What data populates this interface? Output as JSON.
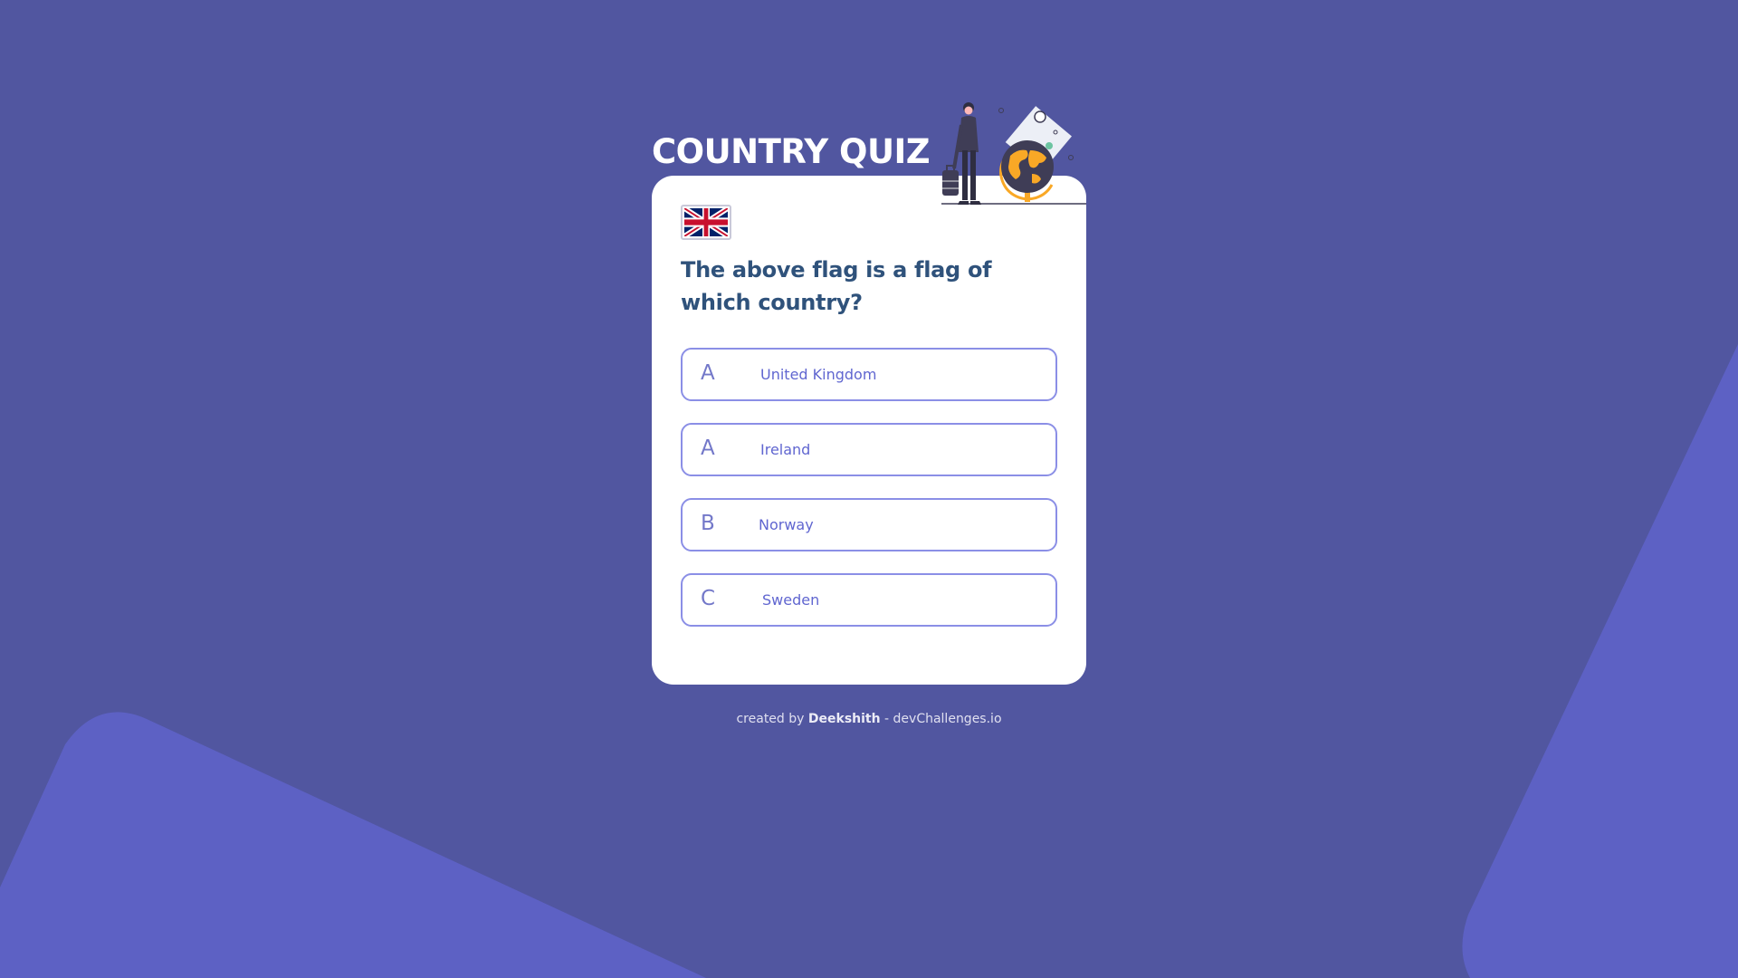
{
  "quiz": {
    "title": "COUNTRY QUIZ",
    "question": "The above flag is a flag of which country?",
    "flag_icon": "uk-flag-icon",
    "options": [
      {
        "letter": "A",
        "text": "United Kingdom"
      },
      {
        "letter": "A",
        "text": "Ireland"
      },
      {
        "letter": "B",
        "text": "Norway"
      },
      {
        "letter": "C",
        "text": "Sweden"
      }
    ]
  },
  "footer": {
    "prefix": "created by",
    "author": "Deekshith",
    "suffix": "- devChallenges.io"
  },
  "colors": {
    "background": "#5156a0",
    "shape": "#5d61c4",
    "card": "#ffffff",
    "question_text": "#2f527b",
    "option_border": "#8b8fe6",
    "option_text": "#6066d0",
    "globe_orange": "#f9a826"
  }
}
